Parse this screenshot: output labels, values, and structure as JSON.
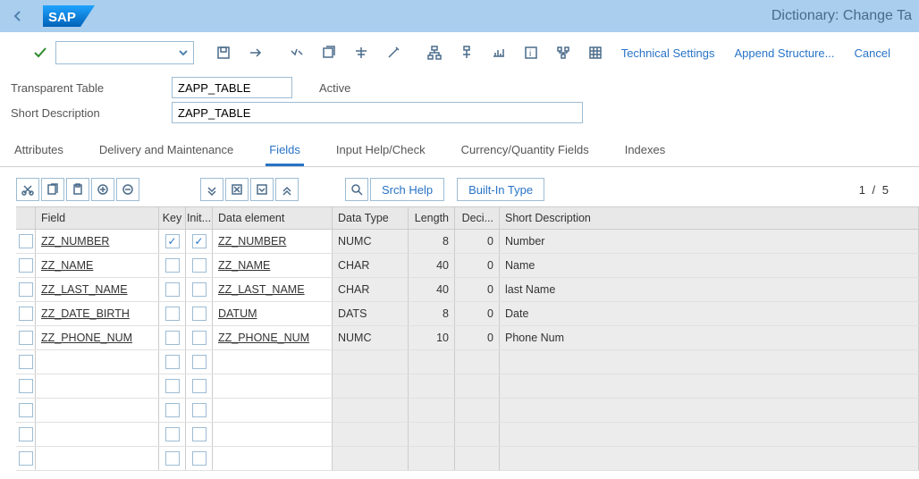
{
  "title": "Dictionary: Change Ta",
  "toolbar": {
    "tech_settings": "Technical Settings",
    "append_structure": "Append Structure...",
    "cancel": "Cancel"
  },
  "form": {
    "table_label": "Transparent Table",
    "table_value": "ZAPP_TABLE",
    "status": "Active",
    "desc_label": "Short Description",
    "desc_value": "ZAPP_TABLE"
  },
  "tabs": {
    "attributes": "Attributes",
    "delivery": "Delivery and Maintenance",
    "fields": "Fields",
    "inputhelp": "Input Help/Check",
    "currency": "Currency/Quantity Fields",
    "indexes": "Indexes"
  },
  "subbar": {
    "srch_help": "Srch Help",
    "builtin": "Built-In Type",
    "counter": "1  /  5"
  },
  "headers": {
    "field": "Field",
    "key": "Key",
    "init": "Init...",
    "de": "Data element",
    "dt": "Data Type",
    "len": "Length",
    "dec": "Deci...",
    "desc": "Short Description"
  },
  "rows": [
    {
      "field": "ZZ_NUMBER",
      "key": true,
      "init": true,
      "de": "ZZ_NUMBER",
      "dt": "NUMC",
      "len": "8",
      "dec": "0",
      "desc": "Number"
    },
    {
      "field": "ZZ_NAME",
      "key": false,
      "init": false,
      "de": "ZZ_NAME",
      "dt": "CHAR",
      "len": "40",
      "dec": "0",
      "desc": "Name"
    },
    {
      "field": "ZZ_LAST_NAME",
      "key": false,
      "init": false,
      "de": "ZZ_LAST_NAME",
      "dt": "CHAR",
      "len": "40",
      "dec": "0",
      "desc": "last Name"
    },
    {
      "field": "ZZ_DATE_BIRTH",
      "key": false,
      "init": false,
      "de": "DATUM",
      "dt": "DATS",
      "len": "8",
      "dec": "0",
      "desc": "Date"
    },
    {
      "field": "ZZ_PHONE_NUM",
      "key": false,
      "init": false,
      "de": "ZZ_PHONE_NUM",
      "dt": "NUMC",
      "len": "10",
      "dec": "0",
      "desc": "Phone Num"
    }
  ],
  "empty_rows": 5
}
